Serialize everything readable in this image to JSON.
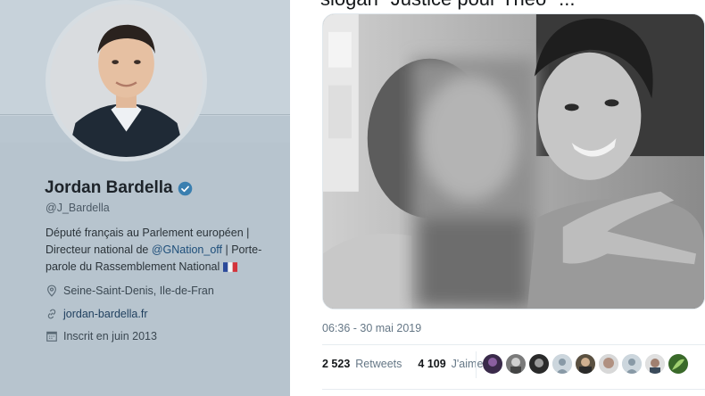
{
  "profile": {
    "name": "Jordan Bardella",
    "handle": "@J_Bardella",
    "bio_line1": "Député français au Parlement européen |",
    "bio_line2_prefix": "Directeur national de ",
    "bio_mention": "@GNation_off",
    "bio_line2_suffix": " | Porte-",
    "bio_line3": "parole du Rassemblement National",
    "location": "Seine-Saint-Denis, Ile-de-Fran",
    "website": "jordan-bardella.fr",
    "joined": "Inscrit en juin 2013",
    "colors": {
      "verified": "#1da1f2",
      "link": "#1d4e7a"
    }
  },
  "tweet": {
    "headline_fragment": "slogan \"Justice pour Theo\" ...",
    "timestamp": "06:36 - 30 mai 2019",
    "retweets_count": "2 523",
    "retweets_label": "Retweets",
    "likes_count": "4 109",
    "likes_label": "J'aime",
    "liker_icons": [
      "avatar-1",
      "avatar-2",
      "avatar-3",
      "default-avatar-icon",
      "avatar-5",
      "avatar-6",
      "default-avatar-icon",
      "avatar-8",
      "avatar-9"
    ]
  }
}
